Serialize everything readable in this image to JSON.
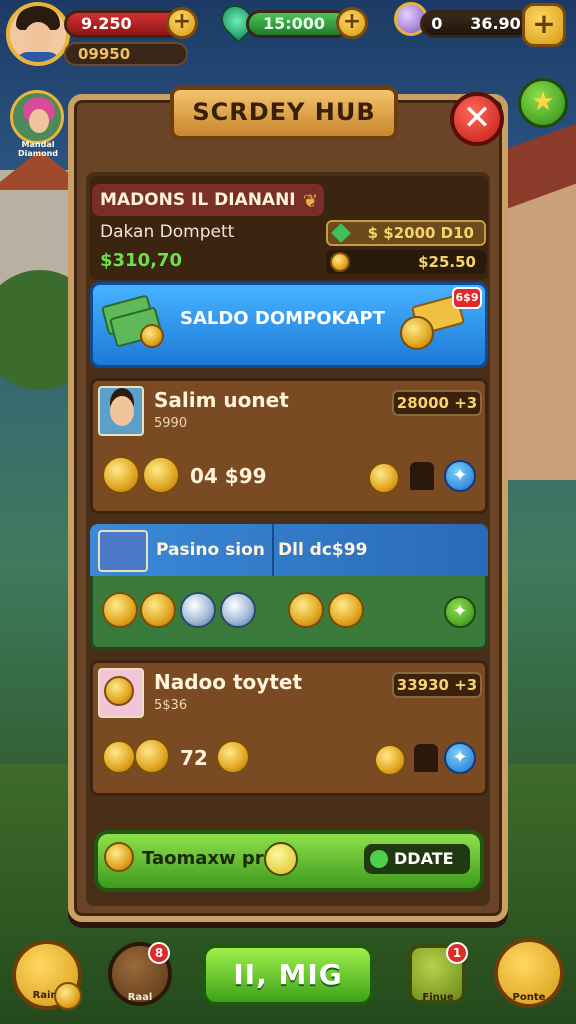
{
  "hud": {
    "cash": "9.250",
    "gems": "15:000",
    "coins_left": "0",
    "coins_right": "36.90",
    "sub_balance": "09950",
    "plus": "+"
  },
  "side_profile": {
    "name": "Mandal Diamond"
  },
  "panel": {
    "title": "SCRDEY HUB",
    "close": "✕"
  },
  "info": {
    "name": "MADONS IL DIANANI",
    "label": "Dakan Dompett",
    "green_amount": "$310,70",
    "pill_amount": "$ $2000 D10",
    "pill2_amount": "$25.50"
  },
  "banner": {
    "label": "SALDO DOMPOKAPT",
    "badge": "6$9"
  },
  "cards": [
    {
      "title": "Salim uonet",
      "sub": "5990",
      "pill": "28000 +3",
      "amount": "04 $99"
    },
    {
      "title": "Pasino sion",
      "pill": "Dll dc$99"
    },
    {
      "title": "Nadoo toytet",
      "sub": "5$36",
      "pill": "33930 +3",
      "amount": "72"
    }
  ],
  "bottom": {
    "label": "Taomaxw prits",
    "update": "DDATE"
  },
  "nav": {
    "shop": "Rair",
    "gift": "Raal",
    "play": "II, MIG",
    "map": "Finue",
    "world": "Ponte",
    "gift_badge": "8",
    "map_badge": "1"
  },
  "icons": {
    "avatar": "player-avatar",
    "star": "star-icon",
    "gem": "gem-icon",
    "coin": "coin-icon"
  }
}
